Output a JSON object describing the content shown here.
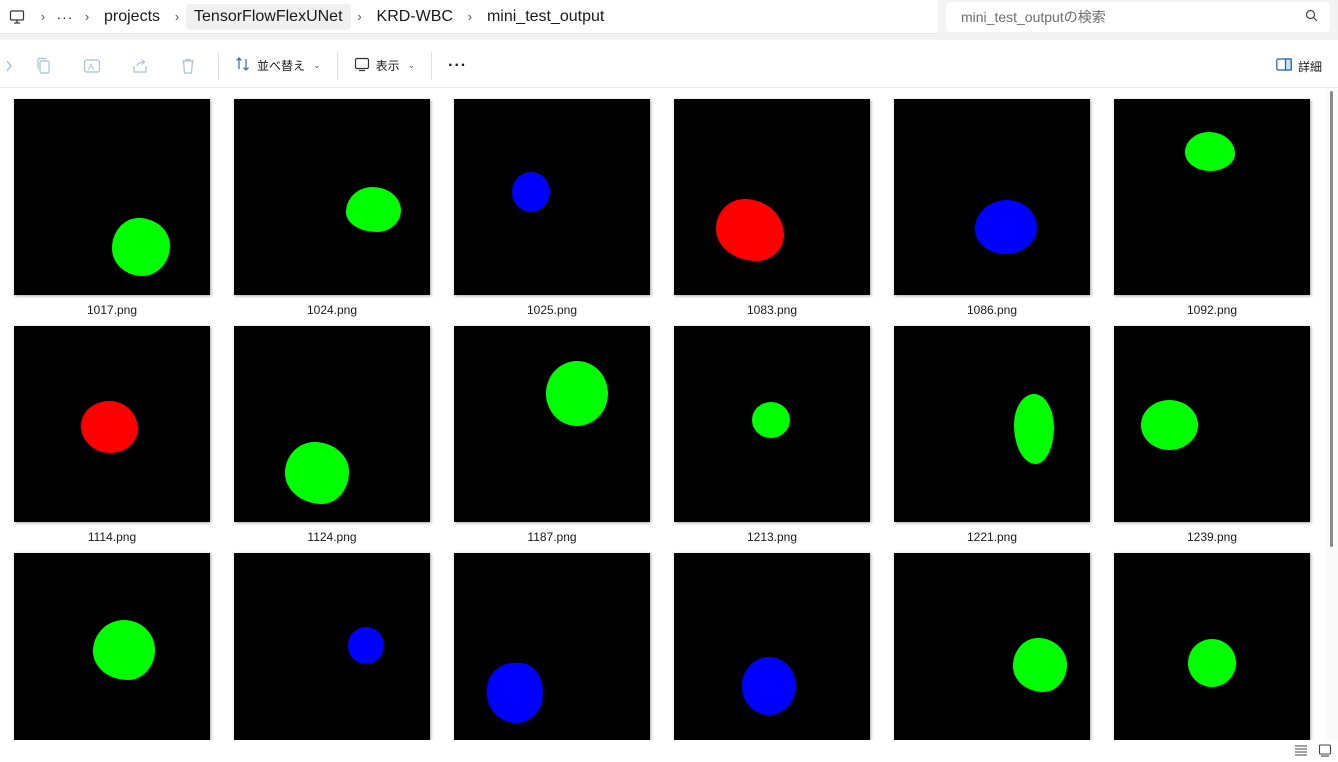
{
  "address_bar": {
    "crumbs": [
      "projects",
      "TensorFlowFlexUNet",
      "KRD-WBC",
      "mini_test_output"
    ],
    "overflow": "···"
  },
  "search": {
    "placeholder": "mini_test_outputの検索"
  },
  "toolbar": {
    "sort_label": "並べ替え",
    "view_label": "表示",
    "more": "···",
    "details_label": "詳細"
  },
  "colors": {
    "green": "#00ff00",
    "red": "#ff0000",
    "blue": "#0000ff",
    "thumb_bg": "#000000"
  },
  "files": [
    {
      "name": "1017.png",
      "blob_color": "green"
    },
    {
      "name": "1024.png",
      "blob_color": "green"
    },
    {
      "name": "1025.png",
      "blob_color": "blue"
    },
    {
      "name": "1083.png",
      "blob_color": "red"
    },
    {
      "name": "1086.png",
      "blob_color": "blue"
    },
    {
      "name": "1092.png",
      "blob_color": "green"
    },
    {
      "name": "1114.png",
      "blob_color": "red"
    },
    {
      "name": "1124.png",
      "blob_color": "green"
    },
    {
      "name": "1187.png",
      "blob_color": "green"
    },
    {
      "name": "1213.png",
      "blob_color": "green"
    },
    {
      "name": "1221.png",
      "blob_color": "green"
    },
    {
      "name": "1239.png",
      "blob_color": "green"
    },
    {
      "name": "",
      "blob_color": "green"
    },
    {
      "name": "",
      "blob_color": "blue"
    },
    {
      "name": "",
      "blob_color": "blue"
    },
    {
      "name": "",
      "blob_color": "blue"
    },
    {
      "name": "",
      "blob_color": "green"
    },
    {
      "name": "",
      "blob_color": "green"
    }
  ]
}
